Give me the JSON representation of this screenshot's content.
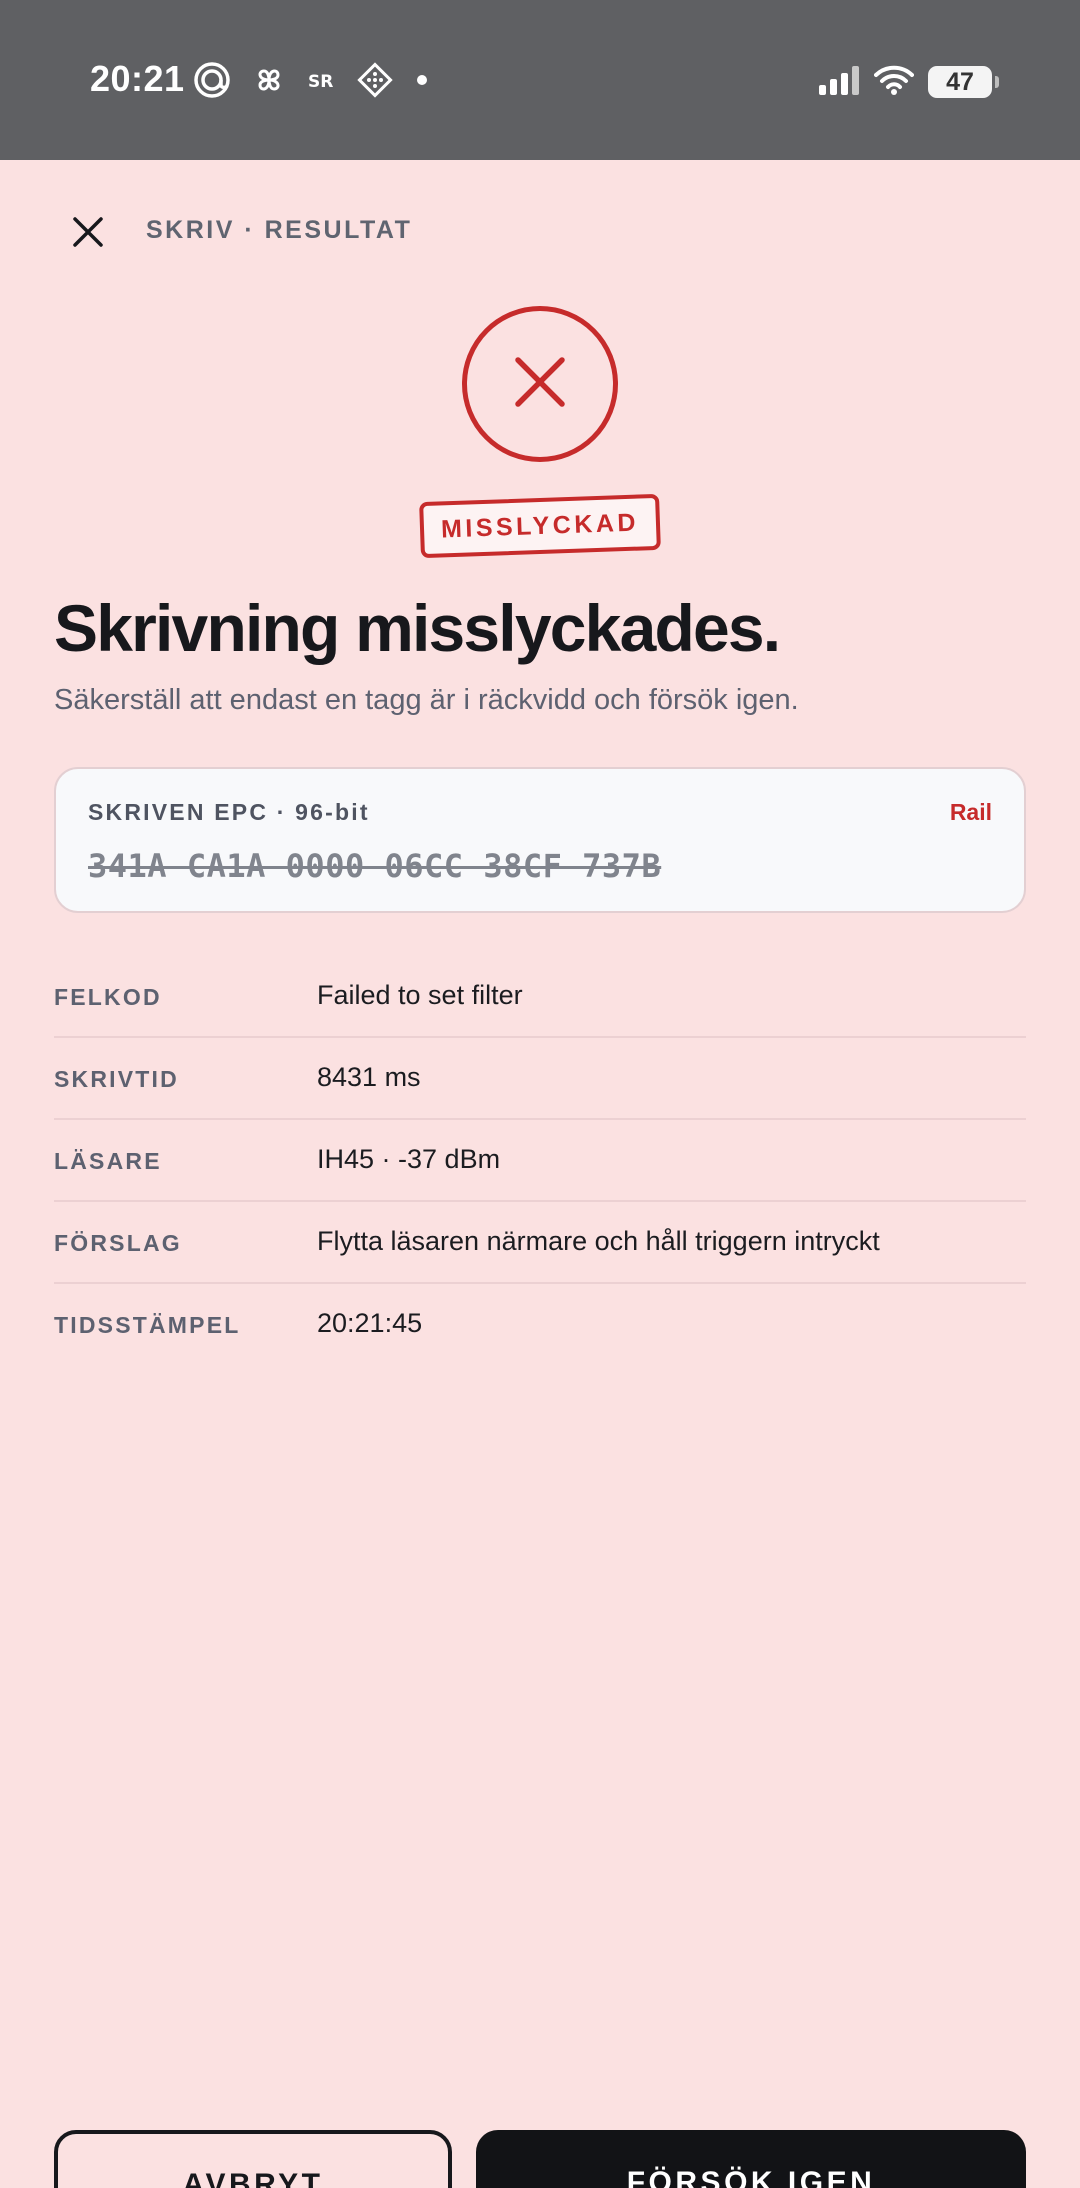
{
  "status_bar": {
    "time": "20:21",
    "battery": "47",
    "icons_left": [
      "threads-icon",
      "pinwheel-icon",
      "sr-icon",
      "diamond-grid-icon",
      "dot-icon"
    ],
    "icons_right": [
      "cellular-signal-icon",
      "wifi-icon",
      "battery-icon"
    ]
  },
  "header": {
    "title": "SKRIV · RESULTAT",
    "close_icon": "close-icon"
  },
  "result": {
    "icon": "fail-x-icon",
    "badge": "MISSLYCKAD",
    "headline": "Skrivning misslyckades.",
    "subtitle": "Säkerställ att endast en tagg är i räckvidd och försök igen."
  },
  "epc_card": {
    "label": "SKRIVEN EPC · 96-bit",
    "tag": "Rail",
    "value": "341A CA1A 0000 06CC 38CF 737B"
  },
  "details": [
    {
      "key": "FELKOD",
      "value": "Failed to set filter"
    },
    {
      "key": "SKRIVTID",
      "value": "8431 ms"
    },
    {
      "key": "LÄSARE",
      "value": "IH45 · -37 dBm"
    },
    {
      "key": "FÖRSLAG",
      "value": "Flytta läsaren närmare och håll triggern intryckt"
    },
    {
      "key": "TIDSSTÄMPEL",
      "value": "20:21:45"
    }
  ],
  "actions": {
    "cancel_label": "AVBRYT",
    "retry_label": "FÖRSÖK IGEN"
  },
  "colors": {
    "background": "#fbe1e1",
    "accent_error": "#c62b2b",
    "text_primary": "#17181c",
    "status_bar": "#5f6063"
  }
}
